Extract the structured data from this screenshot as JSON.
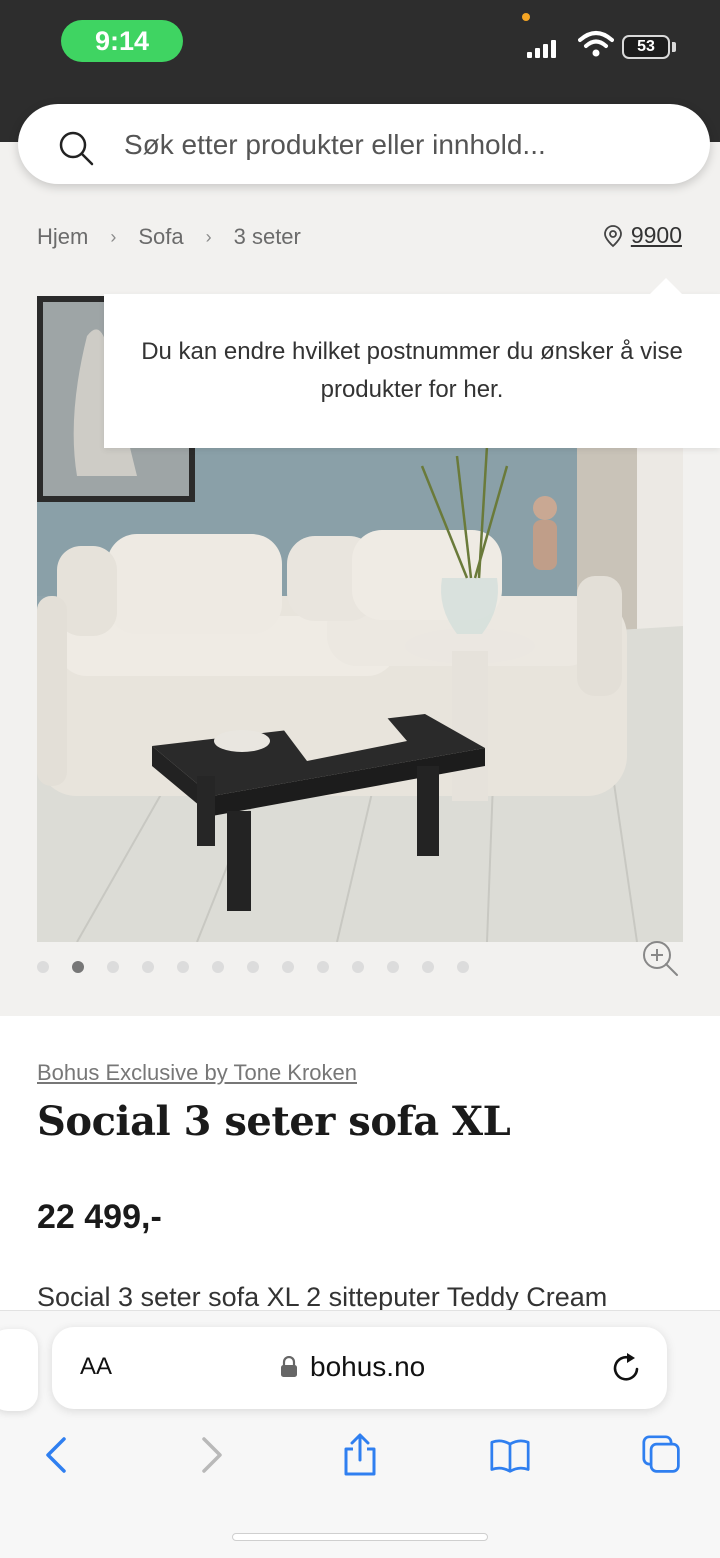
{
  "status_bar": {
    "time": "9:14",
    "battery": "53"
  },
  "search": {
    "placeholder": "Søk etter produkter eller innhold..."
  },
  "breadcrumb": {
    "items": [
      "Hjem",
      "Sofa",
      "3 seter"
    ],
    "separator": "›"
  },
  "location": {
    "postal_code": "9900",
    "icon": "map-pin-icon"
  },
  "tooltip": {
    "text": "Du kan endre hvilket postnummer du ønsker å vise produkter for her."
  },
  "gallery": {
    "image_count": 13,
    "active_index": 1,
    "zoom_icon": "zoom-in-icon"
  },
  "product": {
    "brand": "Bohus Exclusive by Tone Kroken",
    "title": "Social 3 seter sofa XL",
    "price": "22 499,-",
    "description": "Social 3 seter sofa XL 2 sitteputer Teddy Cream"
  },
  "browser": {
    "text_size_label": "AA",
    "url": "bohus.no"
  },
  "colors": {
    "status_bar_bg": "#2d2d2d",
    "time_pill": "#3fd462",
    "accent_blue": "#2f7ff0"
  }
}
